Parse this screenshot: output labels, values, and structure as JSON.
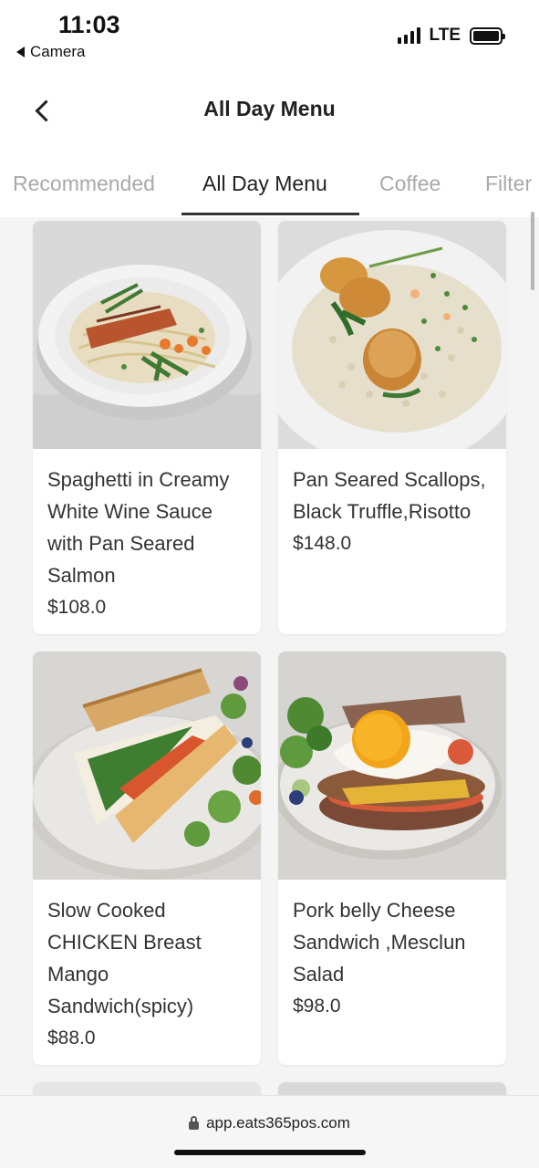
{
  "status_bar": {
    "time": "11:03",
    "back_app": "Camera",
    "network": "LTE"
  },
  "header": {
    "title": "All Day Menu",
    "back_icon": "chevron-left-icon"
  },
  "tabs": [
    {
      "label": "Recommended",
      "active": false
    },
    {
      "label": "All Day Menu",
      "active": true
    },
    {
      "label": "Coffee",
      "active": false
    },
    {
      "label": "Filter",
      "active": false
    }
  ],
  "menu_items": [
    {
      "name": "Spaghetti in Creamy White Wine Sauce with Pan Seared Salmon",
      "price": "$108.0",
      "image": "salmon-pasta"
    },
    {
      "name": "Pan Seared Scallops, Black Truffle,Risotto",
      "price": "$148.0",
      "image": "scallop-risotto"
    },
    {
      "name": "Slow Cooked CHICKEN Breast Mango Sandwich(spicy)",
      "price": "$88.0",
      "image": "chicken-sandwich"
    },
    {
      "name": "Pork belly Cheese Sandwich ,Mesclun Salad",
      "price": "$98.0",
      "image": "pork-belly-sandwich"
    }
  ],
  "browser": {
    "url": "app.eats365pos.com",
    "lock_icon": "lock-icon"
  },
  "colors": {
    "background": "#f4f4f4",
    "card": "#ffffff",
    "text": "#333333",
    "tab_inactive": "#a9a9a9"
  }
}
